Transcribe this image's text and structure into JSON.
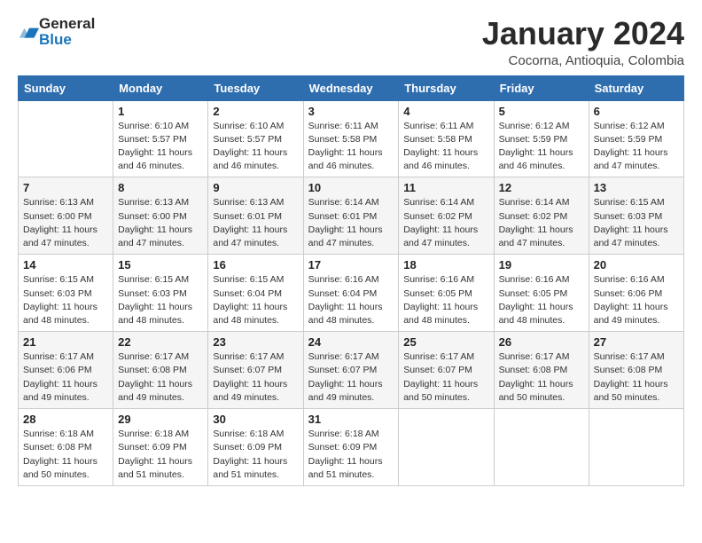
{
  "logo": {
    "line1": "General",
    "line2": "Blue"
  },
  "title": "January 2024",
  "subtitle": "Cocorna, Antioquia, Colombia",
  "headers": [
    "Sunday",
    "Monday",
    "Tuesday",
    "Wednesday",
    "Thursday",
    "Friday",
    "Saturday"
  ],
  "weeks": [
    [
      {
        "day": "",
        "info": ""
      },
      {
        "day": "1",
        "info": "Sunrise: 6:10 AM\nSunset: 5:57 PM\nDaylight: 11 hours\nand 46 minutes."
      },
      {
        "day": "2",
        "info": "Sunrise: 6:10 AM\nSunset: 5:57 PM\nDaylight: 11 hours\nand 46 minutes."
      },
      {
        "day": "3",
        "info": "Sunrise: 6:11 AM\nSunset: 5:58 PM\nDaylight: 11 hours\nand 46 minutes."
      },
      {
        "day": "4",
        "info": "Sunrise: 6:11 AM\nSunset: 5:58 PM\nDaylight: 11 hours\nand 46 minutes."
      },
      {
        "day": "5",
        "info": "Sunrise: 6:12 AM\nSunset: 5:59 PM\nDaylight: 11 hours\nand 46 minutes."
      },
      {
        "day": "6",
        "info": "Sunrise: 6:12 AM\nSunset: 5:59 PM\nDaylight: 11 hours\nand 47 minutes."
      }
    ],
    [
      {
        "day": "7",
        "info": "Sunrise: 6:13 AM\nSunset: 6:00 PM\nDaylight: 11 hours\nand 47 minutes."
      },
      {
        "day": "8",
        "info": "Sunrise: 6:13 AM\nSunset: 6:00 PM\nDaylight: 11 hours\nand 47 minutes."
      },
      {
        "day": "9",
        "info": "Sunrise: 6:13 AM\nSunset: 6:01 PM\nDaylight: 11 hours\nand 47 minutes."
      },
      {
        "day": "10",
        "info": "Sunrise: 6:14 AM\nSunset: 6:01 PM\nDaylight: 11 hours\nand 47 minutes."
      },
      {
        "day": "11",
        "info": "Sunrise: 6:14 AM\nSunset: 6:02 PM\nDaylight: 11 hours\nand 47 minutes."
      },
      {
        "day": "12",
        "info": "Sunrise: 6:14 AM\nSunset: 6:02 PM\nDaylight: 11 hours\nand 47 minutes."
      },
      {
        "day": "13",
        "info": "Sunrise: 6:15 AM\nSunset: 6:03 PM\nDaylight: 11 hours\nand 47 minutes."
      }
    ],
    [
      {
        "day": "14",
        "info": "Sunrise: 6:15 AM\nSunset: 6:03 PM\nDaylight: 11 hours\nand 48 minutes."
      },
      {
        "day": "15",
        "info": "Sunrise: 6:15 AM\nSunset: 6:03 PM\nDaylight: 11 hours\nand 48 minutes."
      },
      {
        "day": "16",
        "info": "Sunrise: 6:15 AM\nSunset: 6:04 PM\nDaylight: 11 hours\nand 48 minutes."
      },
      {
        "day": "17",
        "info": "Sunrise: 6:16 AM\nSunset: 6:04 PM\nDaylight: 11 hours\nand 48 minutes."
      },
      {
        "day": "18",
        "info": "Sunrise: 6:16 AM\nSunset: 6:05 PM\nDaylight: 11 hours\nand 48 minutes."
      },
      {
        "day": "19",
        "info": "Sunrise: 6:16 AM\nSunset: 6:05 PM\nDaylight: 11 hours\nand 48 minutes."
      },
      {
        "day": "20",
        "info": "Sunrise: 6:16 AM\nSunset: 6:06 PM\nDaylight: 11 hours\nand 49 minutes."
      }
    ],
    [
      {
        "day": "21",
        "info": "Sunrise: 6:17 AM\nSunset: 6:06 PM\nDaylight: 11 hours\nand 49 minutes."
      },
      {
        "day": "22",
        "info": "Sunrise: 6:17 AM\nSunset: 6:08 PM\nDaylight: 11 hours\nand 49 minutes."
      },
      {
        "day": "23",
        "info": "Sunrise: 6:17 AM\nSunset: 6:07 PM\nDaylight: 11 hours\nand 49 minutes."
      },
      {
        "day": "24",
        "info": "Sunrise: 6:17 AM\nSunset: 6:07 PM\nDaylight: 11 hours\nand 49 minutes."
      },
      {
        "day": "25",
        "info": "Sunrise: 6:17 AM\nSunset: 6:07 PM\nDaylight: 11 hours\nand 50 minutes."
      },
      {
        "day": "26",
        "info": "Sunrise: 6:17 AM\nSunset: 6:08 PM\nDaylight: 11 hours\nand 50 minutes."
      },
      {
        "day": "27",
        "info": "Sunrise: 6:17 AM\nSunset: 6:08 PM\nDaylight: 11 hours\nand 50 minutes."
      }
    ],
    [
      {
        "day": "28",
        "info": "Sunrise: 6:18 AM\nSunset: 6:08 PM\nDaylight: 11 hours\nand 50 minutes."
      },
      {
        "day": "29",
        "info": "Sunrise: 6:18 AM\nSunset: 6:09 PM\nDaylight: 11 hours\nand 51 minutes."
      },
      {
        "day": "30",
        "info": "Sunrise: 6:18 AM\nSunset: 6:09 PM\nDaylight: 11 hours\nand 51 minutes."
      },
      {
        "day": "31",
        "info": "Sunrise: 6:18 AM\nSunset: 6:09 PM\nDaylight: 11 hours\nand 51 minutes."
      },
      {
        "day": "",
        "info": ""
      },
      {
        "day": "",
        "info": ""
      },
      {
        "day": "",
        "info": ""
      }
    ]
  ]
}
